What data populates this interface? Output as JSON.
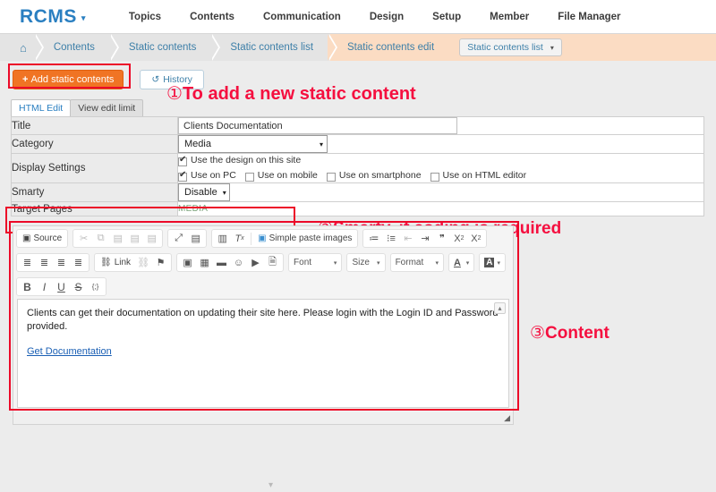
{
  "app": {
    "brand": "RCMS",
    "brand_caret": "▾",
    "accent_blue": "#2a7fc1",
    "accent_orange": "#f07424",
    "annotation_red": "#f50f3f"
  },
  "topnav": {
    "items": [
      {
        "label": "Topics"
      },
      {
        "label": "Contents"
      },
      {
        "label": "Communication"
      },
      {
        "label": "Design"
      },
      {
        "label": "Setup"
      },
      {
        "label": "Member"
      },
      {
        "label": "File Manager"
      }
    ]
  },
  "breadcrumb": {
    "home_icon": "⌂",
    "items": [
      {
        "label": "Contents",
        "highlighted": false
      },
      {
        "label": "Static contents",
        "highlighted": false
      },
      {
        "label": "Static contents list",
        "highlighted": false
      },
      {
        "label": "Static contents edit",
        "highlighted": true
      }
    ],
    "select": {
      "label": "Static contents list",
      "caret": "▾"
    }
  },
  "actions": {
    "add_button": {
      "plus": "+",
      "label": "Add static contents"
    },
    "history_button": {
      "icon": "↺",
      "label": "History"
    }
  },
  "annotations": {
    "one": {
      "marker": "①",
      "text": "To add a new static content"
    },
    "two": {
      "marker": "②",
      "text": "Smarty, if coding is required"
    },
    "three": {
      "marker": "③",
      "text": "Content"
    }
  },
  "tabs": [
    {
      "label": "HTML Edit",
      "selected": true
    },
    {
      "label": "View edit limit",
      "selected": false
    }
  ],
  "form": {
    "rows": {
      "title": {
        "label": "Title",
        "value": "Clients Documentation",
        "placeholder": ""
      },
      "category": {
        "label": "Category",
        "value": "Media",
        "caret": "▾"
      },
      "display_settings": {
        "label": "Display Settings",
        "checkboxes_line1": [
          {
            "label": "Use the design on this site",
            "checked": true
          }
        ],
        "checkboxes_line2": [
          {
            "label": "Use on PC",
            "checked": true
          },
          {
            "label": "Use on mobile",
            "checked": false
          },
          {
            "label": "Use on smartphone",
            "checked": false
          },
          {
            "label": "Use on HTML editor",
            "checked": false
          }
        ]
      },
      "smarty": {
        "label": "Smarty",
        "value": "Disable",
        "caret": "▾"
      },
      "target_pages": {
        "label": "Target Pages",
        "value": "MEDIA"
      }
    }
  },
  "editor": {
    "toolbar_row1": [
      {
        "group": [
          {
            "icon": "▣",
            "name": "source-icon",
            "label": "Source",
            "disabled": false
          }
        ]
      },
      {
        "group": [
          {
            "icon": "✂",
            "name": "cut-icon",
            "label": "",
            "disabled": true
          },
          {
            "icon": "⧉",
            "name": "copy-icon",
            "label": "",
            "disabled": true
          },
          {
            "icon": "📋",
            "name": "paste-icon",
            "label": "",
            "disabled": true
          },
          {
            "icon": "📋",
            "name": "paste-text-icon",
            "label": "",
            "disabled": true
          },
          {
            "icon": "📋",
            "name": "paste-word-icon",
            "label": "",
            "disabled": true
          }
        ]
      },
      {
        "group": [
          {
            "icon": "⤢",
            "name": "maximize-icon",
            "label": "",
            "disabled": false
          },
          {
            "icon": "▤",
            "name": "show-blocks-icon",
            "label": "",
            "disabled": false
          }
        ]
      },
      {
        "group": [
          {
            "icon": "▥",
            "name": "templates-icon",
            "label": "",
            "disabled": false
          },
          {
            "icon": "Tx",
            "name": "remove-format-icon",
            "label": "",
            "disabled": false
          },
          {
            "icon": "🖼",
            "name": "simple-paste-images-icon",
            "label": "Simple paste images",
            "disabled": false
          }
        ]
      },
      {
        "group": [
          {
            "icon": "≣",
            "name": "numbered-list-icon",
            "label": "",
            "disabled": false
          },
          {
            "icon": "≔",
            "name": "bulleted-list-icon",
            "label": "",
            "disabled": false
          },
          {
            "icon": "⇤",
            "name": "outdent-icon",
            "label": "",
            "disabled": true
          },
          {
            "icon": "⇥",
            "name": "indent-icon",
            "label": "",
            "disabled": false
          },
          {
            "icon": "❞",
            "name": "blockquote-icon",
            "label": "",
            "disabled": false
          },
          {
            "icon": "X₂",
            "name": "subscript-icon",
            "label": "",
            "disabled": false
          },
          {
            "icon": "X²",
            "name": "superscript-icon",
            "label": "",
            "disabled": false
          }
        ]
      }
    ],
    "toolbar_row2": [
      {
        "group": [
          {
            "icon": "≡",
            "name": "align-left-icon",
            "label": "",
            "disabled": false
          },
          {
            "icon": "≡",
            "name": "align-center-icon",
            "label": "",
            "disabled": false
          },
          {
            "icon": "≡",
            "name": "align-right-icon",
            "label": "",
            "disabled": false
          },
          {
            "icon": "≡",
            "name": "align-justify-icon",
            "label": "",
            "disabled": false
          }
        ]
      },
      {
        "group": [
          {
            "icon": "⛓",
            "name": "link-icon",
            "label": "Link",
            "disabled": false
          },
          {
            "icon": "⛓",
            "name": "unlink-icon",
            "label": "",
            "disabled": true
          },
          {
            "icon": "⚑",
            "name": "anchor-icon",
            "label": "",
            "disabled": false
          }
        ]
      },
      {
        "group": [
          {
            "icon": "🖼",
            "name": "image-icon",
            "label": "",
            "disabled": false
          },
          {
            "icon": "▦",
            "name": "table-icon",
            "label": "",
            "disabled": false
          },
          {
            "icon": "―",
            "name": "horizontal-rule-icon",
            "label": "",
            "disabled": false
          },
          {
            "icon": "☺",
            "name": "smiley-icon",
            "label": "",
            "disabled": false
          },
          {
            "icon": "▶",
            "name": "video-icon",
            "label": "",
            "disabled": false
          },
          {
            "icon": "🗎",
            "name": "page-break-icon",
            "label": "",
            "disabled": false
          }
        ]
      },
      {
        "dropdowns": [
          {
            "label": "Font",
            "name": "font-dropdown",
            "caret": "▾"
          },
          {
            "label": "Size",
            "name": "size-dropdown",
            "caret": "▾"
          },
          {
            "label": "Format",
            "name": "format-dropdown",
            "caret": "▾"
          }
        ]
      },
      {
        "colors": [
          {
            "label": "A",
            "name": "text-color-dropdown",
            "caret": "▾"
          },
          {
            "label": "A",
            "name": "background-color-dropdown",
            "caret": "▾"
          }
        ]
      }
    ],
    "toolbar_row3": [
      {
        "group": [
          {
            "icon": "B",
            "name": "bold-icon",
            "label": "",
            "disabled": false
          },
          {
            "icon": "I",
            "name": "italic-icon",
            "label": "",
            "disabled": false
          },
          {
            "icon": "U",
            "name": "underline-icon",
            "label": "",
            "disabled": false
          },
          {
            "icon": "S",
            "name": "strikethrough-icon",
            "label": "",
            "disabled": false
          },
          {
            "icon": "{;}",
            "name": "code-icon",
            "label": "",
            "disabled": false
          }
        ]
      }
    ],
    "content": {
      "paragraph": "Clients can get their documentation on updating their site here. Please login with the Login ID and Password provided.",
      "link": "Get Documentation"
    },
    "collapse_icon": "▴",
    "resize_icon": "◢"
  },
  "footer": {
    "caret": "▾"
  }
}
